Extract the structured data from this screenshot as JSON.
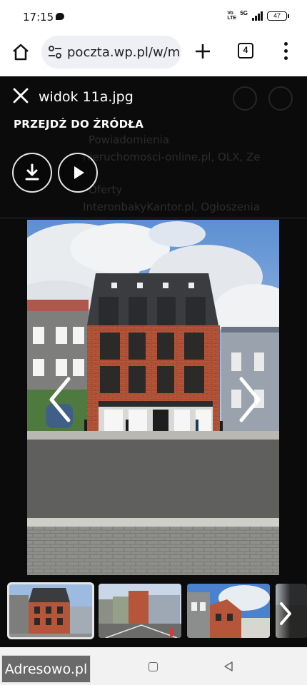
{
  "status_bar": {
    "time": "17:15",
    "network_type": "5G",
    "volte": "Vo LTE",
    "battery": "47",
    "icons": [
      "chat-bubble-icon",
      "signal-icon",
      "battery-icon"
    ]
  },
  "browser": {
    "url": "poczta.wp.pl/w/m",
    "tab_count": "4",
    "icons": [
      "home-icon",
      "site-settings-icon",
      "plus-icon",
      "tabs-icon",
      "more-vert-icon"
    ]
  },
  "viewer": {
    "filename": "widok 11a.jpg",
    "source_link": "PRZEJDŹ DO ŹRÓDŁA",
    "icons": [
      "close-icon",
      "download-icon",
      "play-icon",
      "chevron-left-icon",
      "chevron-right-icon"
    ]
  },
  "background_email": {
    "line1": "Powiadomienia",
    "line2": "nieruchomosci-online.pl, OLX, Ze",
    "line3": "Oferty",
    "line4": "InteronbakyKantor.pl, Ogłoszenia"
  },
  "thumbnails": {
    "count_visible": 4,
    "active_index": 0
  },
  "watermark": "Adresowo.pl",
  "colors": {
    "viewer_background": "#0b0b0b",
    "brick": "#b5553a",
    "roof": "#3b3c40",
    "sky": "#6f9fd8",
    "url_pill": "#eef0f5"
  }
}
